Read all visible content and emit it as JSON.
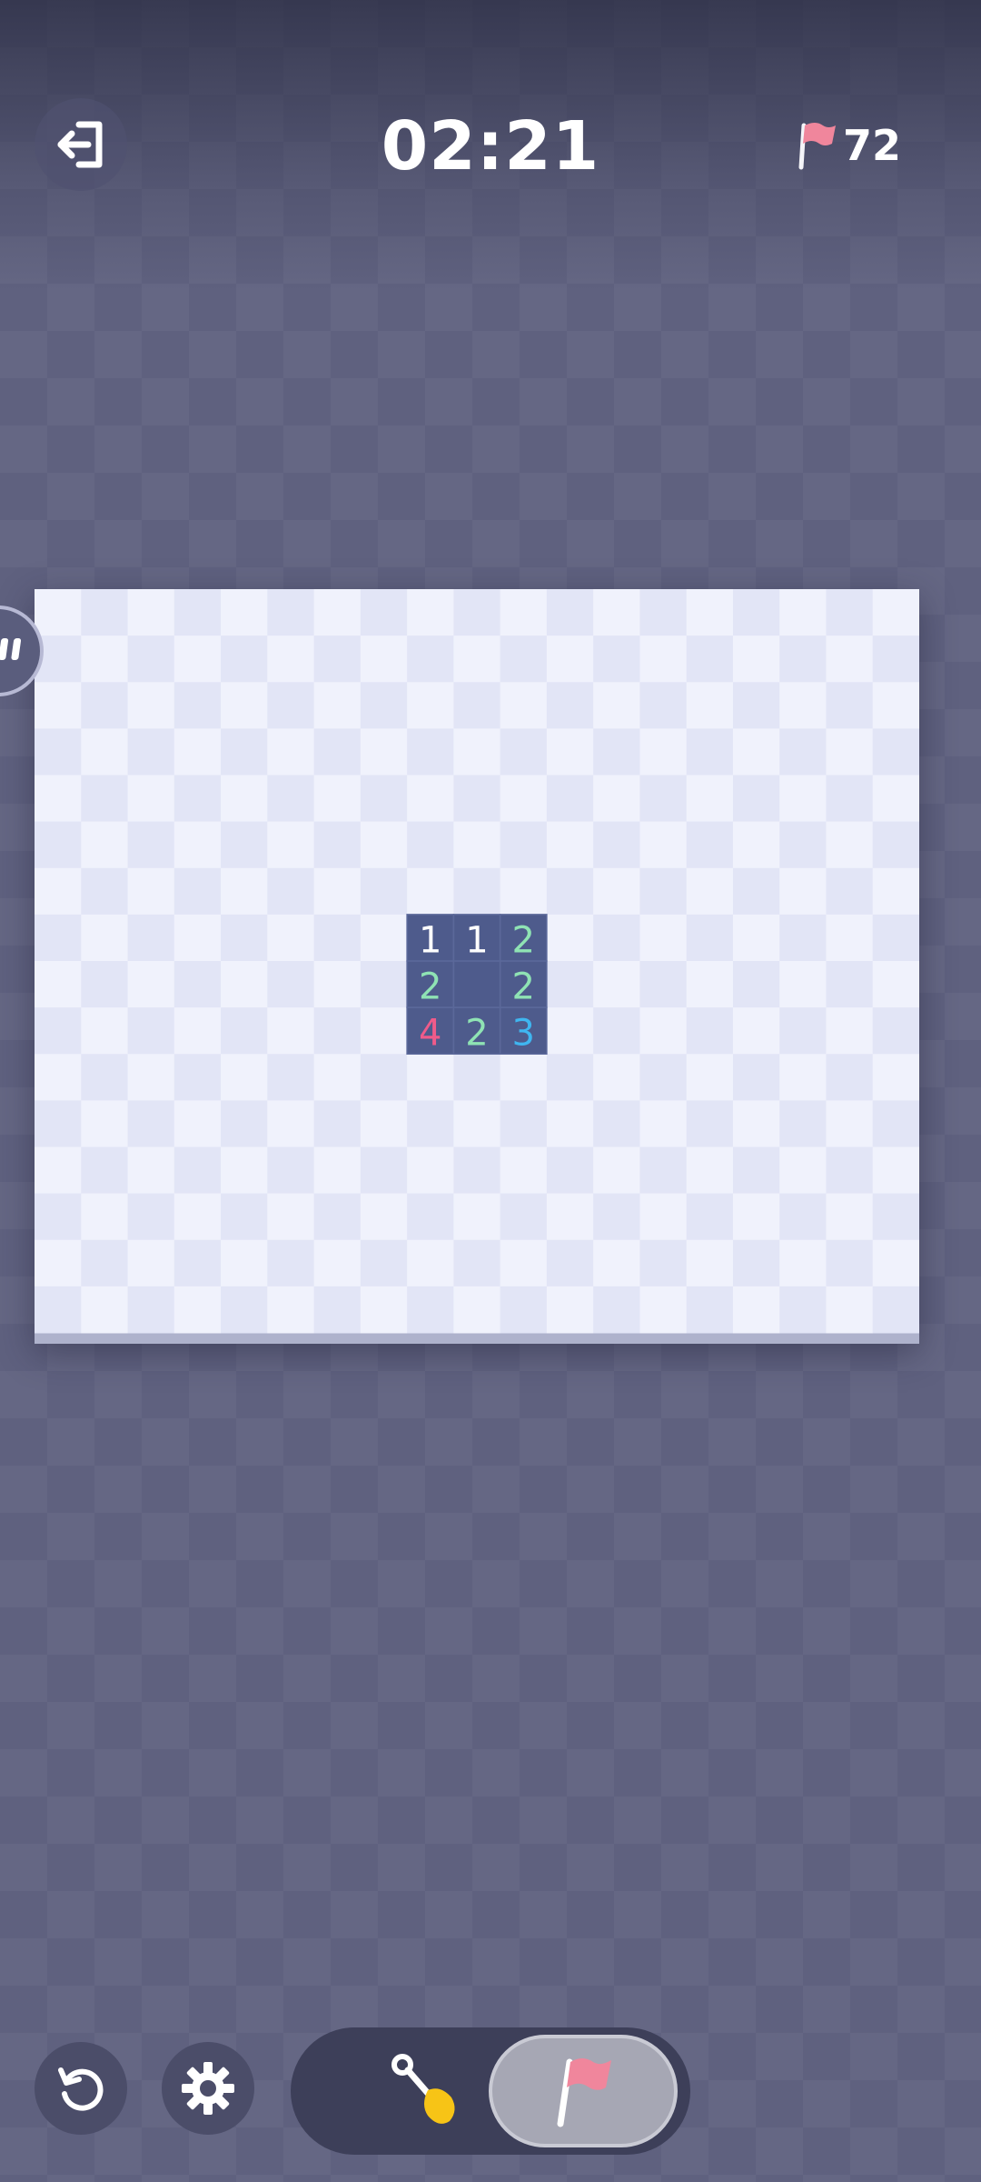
{
  "header": {
    "timer": "02:21",
    "flags_remaining": "72"
  },
  "board": {
    "columns": 19,
    "rows": 16,
    "revealed": [
      {
        "row": 7,
        "col": 8,
        "value": "1"
      },
      {
        "row": 7,
        "col": 9,
        "value": "1"
      },
      {
        "row": 7,
        "col": 10,
        "value": "2"
      },
      {
        "row": 8,
        "col": 8,
        "value": "2"
      },
      {
        "row": 8,
        "col": 9,
        "value": ""
      },
      {
        "row": 8,
        "col": 10,
        "value": "2"
      },
      {
        "row": 9,
        "col": 8,
        "value": "4"
      },
      {
        "row": 9,
        "col": 9,
        "value": "2"
      },
      {
        "row": 9,
        "col": 10,
        "value": "3"
      }
    ]
  },
  "number_colors": {
    "1": "#ffffff",
    "2": "#8fe3b4",
    "3": "#3fb6f0",
    "4": "#ef5b8a"
  },
  "colors": {
    "tile_light": "#f0f2fc",
    "tile_dark": "#e2e5f6",
    "revealed": "#4e5b8c",
    "flag": "#f0869c",
    "shovel_head": "#f7c416"
  },
  "bottom": {
    "active_mode": "flag"
  },
  "icons": {
    "exit": "exit-icon",
    "flag": "flag-icon",
    "restart": "restart-icon",
    "settings": "gear-icon",
    "dig": "shovel-icon",
    "handle": "drag-handle-icon"
  }
}
